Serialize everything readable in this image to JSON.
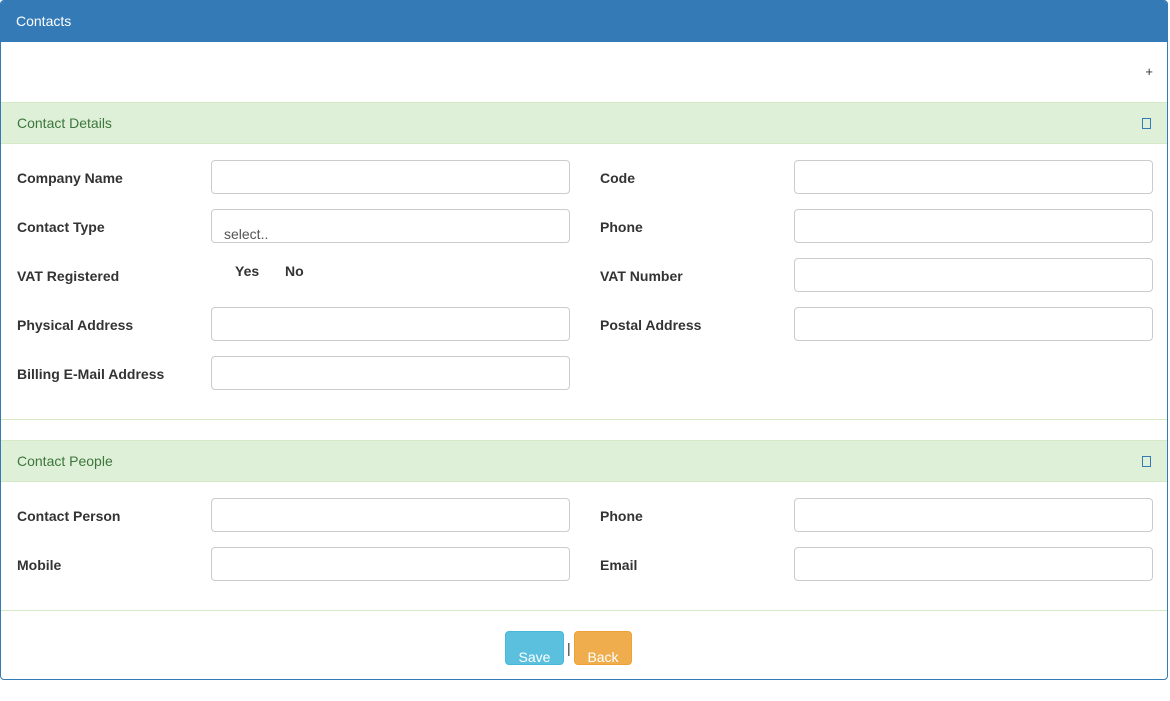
{
  "header": {
    "title": "Contacts"
  },
  "toolbar": {
    "add_label": "+"
  },
  "contact_details": {
    "title": "Contact Details",
    "company_name_label": "Company Name",
    "code_label": "Code",
    "contact_type_label": "Contact Type",
    "contact_type_value": "select..",
    "phone_label": "Phone",
    "vat_registered_label": "VAT Registered",
    "vat_yes": "Yes",
    "vat_no": "No",
    "vat_number_label": "VAT Number",
    "physical_address_label": "Physical Address",
    "postal_address_label": "Postal Address",
    "billing_email_label": "Billing E-Mail Address"
  },
  "contact_people": {
    "title": "Contact People",
    "contact_person_label": "Contact Person",
    "phone_label": "Phone",
    "mobile_label": "Mobile",
    "email_label": "Email"
  },
  "footer": {
    "save_label": "Save",
    "separator": "|",
    "back_label": "Back"
  },
  "colors": {
    "primary": "#337ab7",
    "success_bg": "#dff0d8",
    "success_text": "#3c763d",
    "info": "#5bc0de",
    "warning": "#f0ad4e"
  }
}
